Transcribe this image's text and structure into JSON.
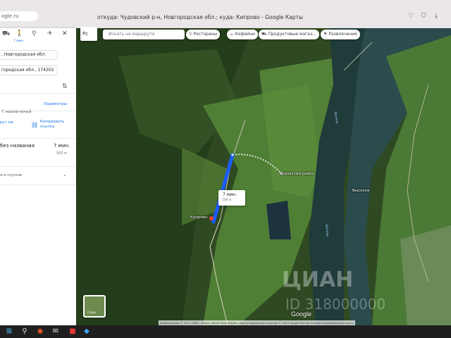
{
  "browser": {
    "url_fragment": "ogle.ru",
    "window_title": "откуда: Чудовский р-н, Новгородская обл.; куда: Кипрово - Google Карты"
  },
  "panel": {
    "walk_time_label": "7 мин.",
    "origin_value": ", Новгородская обл.",
    "destination_value": "городская обл., 174202",
    "add_destination": "т назначения",
    "settings_link": "Параметры",
    "send_route": "рут на",
    "copy_link": "Копировать ссылку",
    "route_name": "без названия",
    "route_time": "7 мин.",
    "route_distance": "500 м",
    "route_options": "м и спусков"
  },
  "map": {
    "lang_button": "Рс",
    "search_placeholder": "Искать на маршруте",
    "chips": [
      {
        "icon": "fork-knife-icon",
        "glyph": "⚲",
        "label": "Рестораны"
      },
      {
        "icon": "coffee-icon",
        "glyph": "☕",
        "label": "Кофейни"
      },
      {
        "icon": "cart-icon",
        "glyph": "⛟",
        "label": "Продуктовые магаз..."
      },
      {
        "icon": "ticket-icon",
        "glyph": "⚑",
        "label": "Развлечения"
      }
    ],
    "place_chudovsky": "Чудовский район",
    "place_kiprovo": "Кипрово",
    "place_vysokoe": "Высокое",
    "river_1": "Волхов",
    "river_2": "Волхов",
    "callout_time": "7 мин.",
    "callout_distance": "500 м",
    "layers_label": "Слои",
    "google_logo": "Google",
    "attribution": "Изображения © 2024 CNES / Airbus, Maxar Technologies, Картографические данные © 2024 Google   Россия   Условия   Конфиденциальность",
    "watermark": "ЦИАН",
    "watermark_id": "ID 318000000"
  },
  "colors": {
    "route_blue": "#1a5cff",
    "panel_bg": "#ffffff",
    "link_blue": "#1a73e8"
  }
}
